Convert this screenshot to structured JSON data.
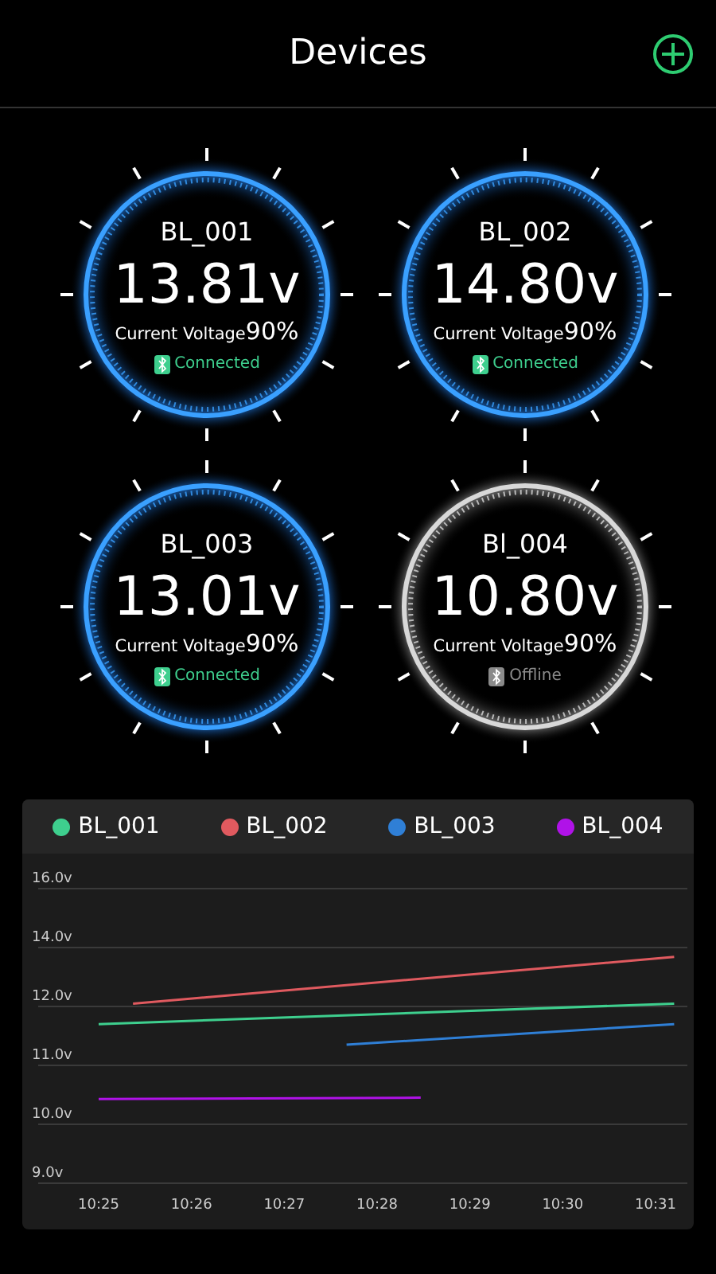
{
  "header": {
    "title": "Devices"
  },
  "devices": [
    {
      "name": "BL_001",
      "voltage": "13.81v",
      "label": "Current Voltage",
      "percent": "90%",
      "status": "Connected",
      "kind": "online"
    },
    {
      "name": "BL_002",
      "voltage": "14.80v",
      "label": "Current Voltage",
      "percent": "90%",
      "status": "Connected",
      "kind": "online"
    },
    {
      "name": "BL_003",
      "voltage": "13.01v",
      "label": "Current Voltage",
      "percent": "90%",
      "status": "Connected",
      "kind": "online"
    },
    {
      "name": "Bl_004",
      "voltage": "10.80v",
      "label": "Current Voltage",
      "percent": "90%",
      "status": "Offline",
      "kind": "offline"
    }
  ],
  "chart_panel": {
    "legend": [
      {
        "name": "BL_001",
        "color": "#3ecf8e"
      },
      {
        "name": "BL_002",
        "color": "#e05a5f"
      },
      {
        "name": "BL_003",
        "color": "#2f7fd6"
      },
      {
        "name": "BL_004",
        "color": "#b012e8"
      }
    ],
    "y_labels": [
      "16.0v",
      "14.0v",
      "12.0v",
      "11.0v",
      "10.0v",
      "9.0v"
    ],
    "x_labels": [
      "10:25",
      "10:26",
      "10:27",
      "10:28",
      "10:29",
      "10:30",
      "10:31"
    ]
  }
}
